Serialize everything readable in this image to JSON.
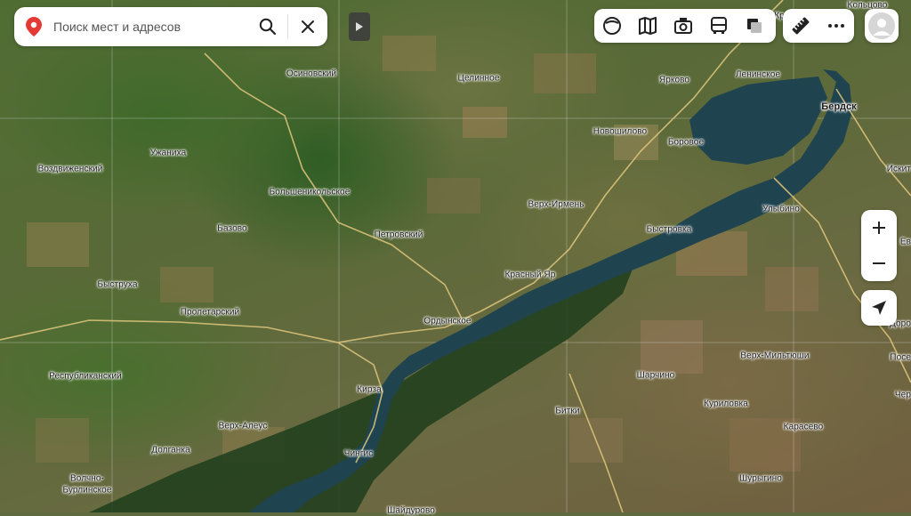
{
  "search": {
    "placeholder": "Поиск мест и адресов"
  },
  "icons": {
    "search_pin": "location-pin-icon",
    "search": "magnifier-icon",
    "clear": "close-icon",
    "collapse": "play-triangle-icon",
    "layers": [
      "panorama-icon",
      "map-book-icon",
      "photo-camera-icon",
      "bus-icon",
      "layers-icon"
    ],
    "tools": [
      "ruler-icon",
      "more-dots-icon"
    ],
    "avatar": "user-avatar-icon",
    "zoom_in": "plus-icon",
    "zoom_out": "minus-icon",
    "locate": "navigation-arrow-icon"
  },
  "colors": {
    "pin": "#e53935",
    "water": "#1f4450",
    "roads": "#d9c27a"
  },
  "map": {
    "type": "satellite",
    "labels": {
      "kolcovo": "Кольцово",
      "kr": "Кр",
      "osinovskiy": "Осиновский",
      "celinnoe": "Целинное",
      "yarkovo": "Ярково",
      "leninskoe": "Ленинское",
      "berdsk": "Бердск",
      "novoshilovo": "Новошилово",
      "borovoe": "Боровое",
      "uzhaniha": "Ужаниха",
      "vozdvizhenskiy": "Воздвиженский",
      "bolshenikolskoe": "Большеникольское",
      "iskit": "Искит",
      "verh_irmen": "Верх-Ирмень",
      "ulybino": "Улыбино",
      "bazovo": "Базово",
      "petrovskiy": "Петровский",
      "bystrovka": "Быстровка",
      "ev": "Ев",
      "krasny_yar": "Красный Яр",
      "bystruha": "Быструха",
      "proletarskiy": "Пролетарский",
      "ordynskoe": "Ордынское",
      "doro": "Доро",
      "verh_miltyushi": "Верх-Мильтюши",
      "pose": "Посе",
      "respublikanskiy": "Республиканский",
      "sharchino": "Шарчино",
      "kirza": "Кирза",
      "cher": "Чер",
      "kurilovka": "Куриловка",
      "bitki": "Битки",
      "verh_aleus": "Верх-Алеус",
      "karasevo": "Карасево",
      "dolganka": "Долганка",
      "chingis": "Чингис",
      "volchno_burlinskoe_1": "Волчно-",
      "volchno_burlinskoe_2": "Бурлинское",
      "shurygino": "Шурыгино",
      "shayd": "Шайдурово"
    }
  }
}
